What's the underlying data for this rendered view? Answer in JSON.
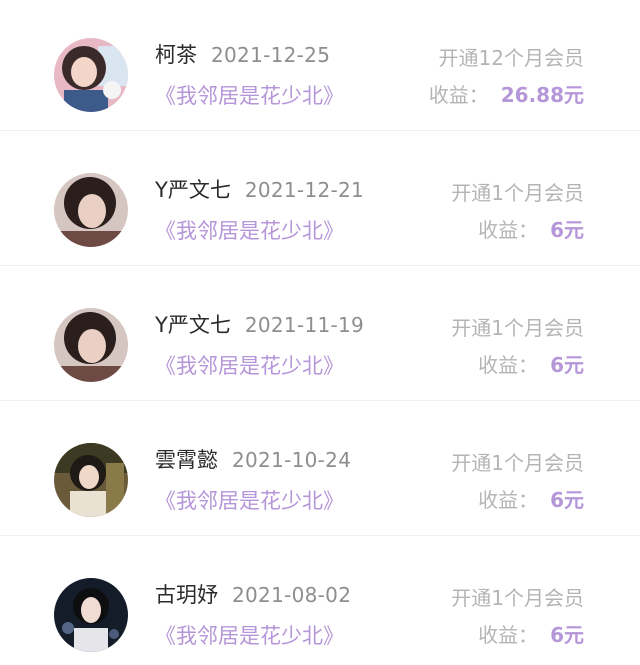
{
  "earning_label": "收益：",
  "records": [
    {
      "name": "柯茶",
      "date": "2021-12-25",
      "book": "《我邻居是花少北》",
      "plan": "开通12个月会员",
      "amount": "26.88元",
      "avatar_icon": "girl-portrait-pink-icon"
    },
    {
      "name": "Y严文七",
      "date": "2021-12-21",
      "book": "《我邻居是花少北》",
      "plan": "开通1个月会员",
      "amount": "6元",
      "avatar_icon": "girl-portrait-dark-hair-icon"
    },
    {
      "name": "Y严文七",
      "date": "2021-11-19",
      "book": "《我邻居是花少北》",
      "plan": "开通1个月会员",
      "amount": "6元",
      "avatar_icon": "girl-portrait-dark-hair-icon"
    },
    {
      "name": "雲霄懿",
      "date": "2021-10-24",
      "book": "《我邻居是花少北》",
      "plan": "开通1个月会员",
      "amount": "6元",
      "avatar_icon": "girl-portrait-outdoor-icon"
    },
    {
      "name": "古玥妤",
      "date": "2021-08-02",
      "book": "《我邻居是花少北》",
      "plan": "开通1个月会员",
      "amount": "6元",
      "avatar_icon": "girl-portrait-night-icon"
    }
  ]
}
